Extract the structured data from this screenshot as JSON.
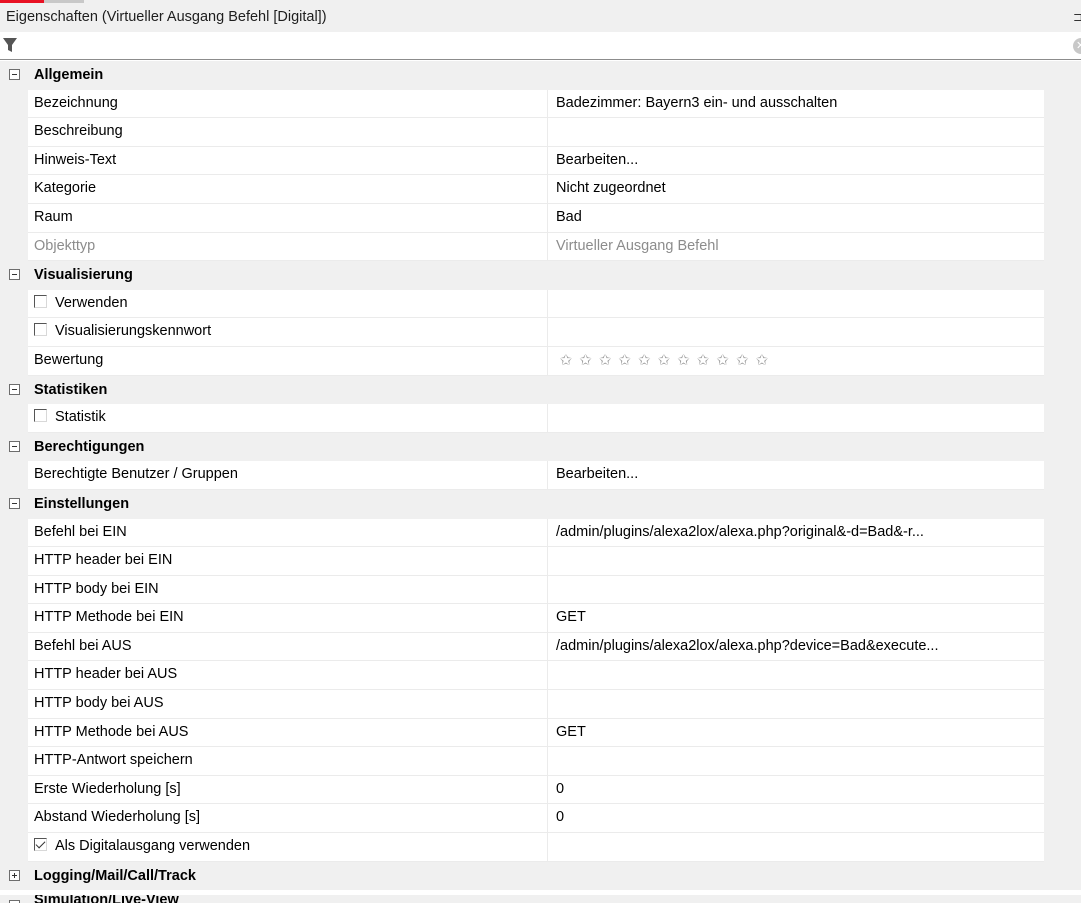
{
  "window": {
    "title": "Eigenschaften (Virtueller Ausgang Befehl [Digital])",
    "pin_glyph": "ₐ"
  },
  "filter": {
    "icon": "filter-icon",
    "clear_icon": "clear-icon"
  },
  "categories": {
    "allgemein": "Allgemein",
    "visualisierung": "Visualisierung",
    "statistiken": "Statistiken",
    "berechtigungen": "Berechtigungen",
    "einstellungen": "Einstellungen",
    "logging": "Logging/Mail/Call/Track",
    "partial": "Simulation/Live-View"
  },
  "allgemein": {
    "bezeichnung": {
      "name": "Bezeichnung",
      "value": "Badezimmer: Bayern3 ein- und ausschalten"
    },
    "beschreibung": {
      "name": "Beschreibung",
      "value": ""
    },
    "hinweis": {
      "name": "Hinweis-Text",
      "value": "Bearbeiten..."
    },
    "kategorie": {
      "name": "Kategorie",
      "value": "Nicht zugeordnet"
    },
    "raum": {
      "name": "Raum",
      "value": "Bad"
    },
    "objekttyp": {
      "name": "Objekttyp",
      "value": "Virtueller Ausgang Befehl"
    }
  },
  "visualisierung": {
    "verwenden": {
      "name": "Verwenden",
      "checked": false
    },
    "kennwort": {
      "name": "Visualisierungskennwort",
      "checked": false
    },
    "bewertung": {
      "name": "Bewertung",
      "stars": 0,
      "max_stars": 11
    }
  },
  "statistiken": {
    "statistik": {
      "name": "Statistik",
      "checked": false
    }
  },
  "berechtigungen": {
    "benutzer": {
      "name": "Berechtigte Benutzer / Gruppen",
      "value": "Bearbeiten..."
    }
  },
  "einstellungen": {
    "befehl_ein": {
      "name": "Befehl bei EIN",
      "value": "/admin/plugins/alexa2lox/alexa.php?original&-d=Bad&-r..."
    },
    "header_ein": {
      "name": "HTTP header bei EIN",
      "value": ""
    },
    "body_ein": {
      "name": "HTTP body bei EIN",
      "value": ""
    },
    "methode_ein": {
      "name": "HTTP Methode bei EIN",
      "value": "GET"
    },
    "befehl_aus": {
      "name": "Befehl bei AUS",
      "value": "/admin/plugins/alexa2lox/alexa.php?device=Bad&execute..."
    },
    "header_aus": {
      "name": "HTTP header bei AUS",
      "value": ""
    },
    "body_aus": {
      "name": "HTTP body bei AUS",
      "value": ""
    },
    "methode_aus": {
      "name": "HTTP Methode bei AUS",
      "value": "GET"
    },
    "antwort": {
      "name": "HTTP-Antwort speichern",
      "value": ""
    },
    "erste": {
      "name": "Erste Wiederholung [s]",
      "value": "0"
    },
    "abstand": {
      "name": "Abstand Wiederholung [s]",
      "value": "0"
    },
    "digital": {
      "name": "Als Digitalausgang verwenden",
      "checked": true
    }
  },
  "colors": {
    "category_bg": "#f0f0f0",
    "gridline": "#ebebeb",
    "disabled_text": "#8c8c8c"
  }
}
